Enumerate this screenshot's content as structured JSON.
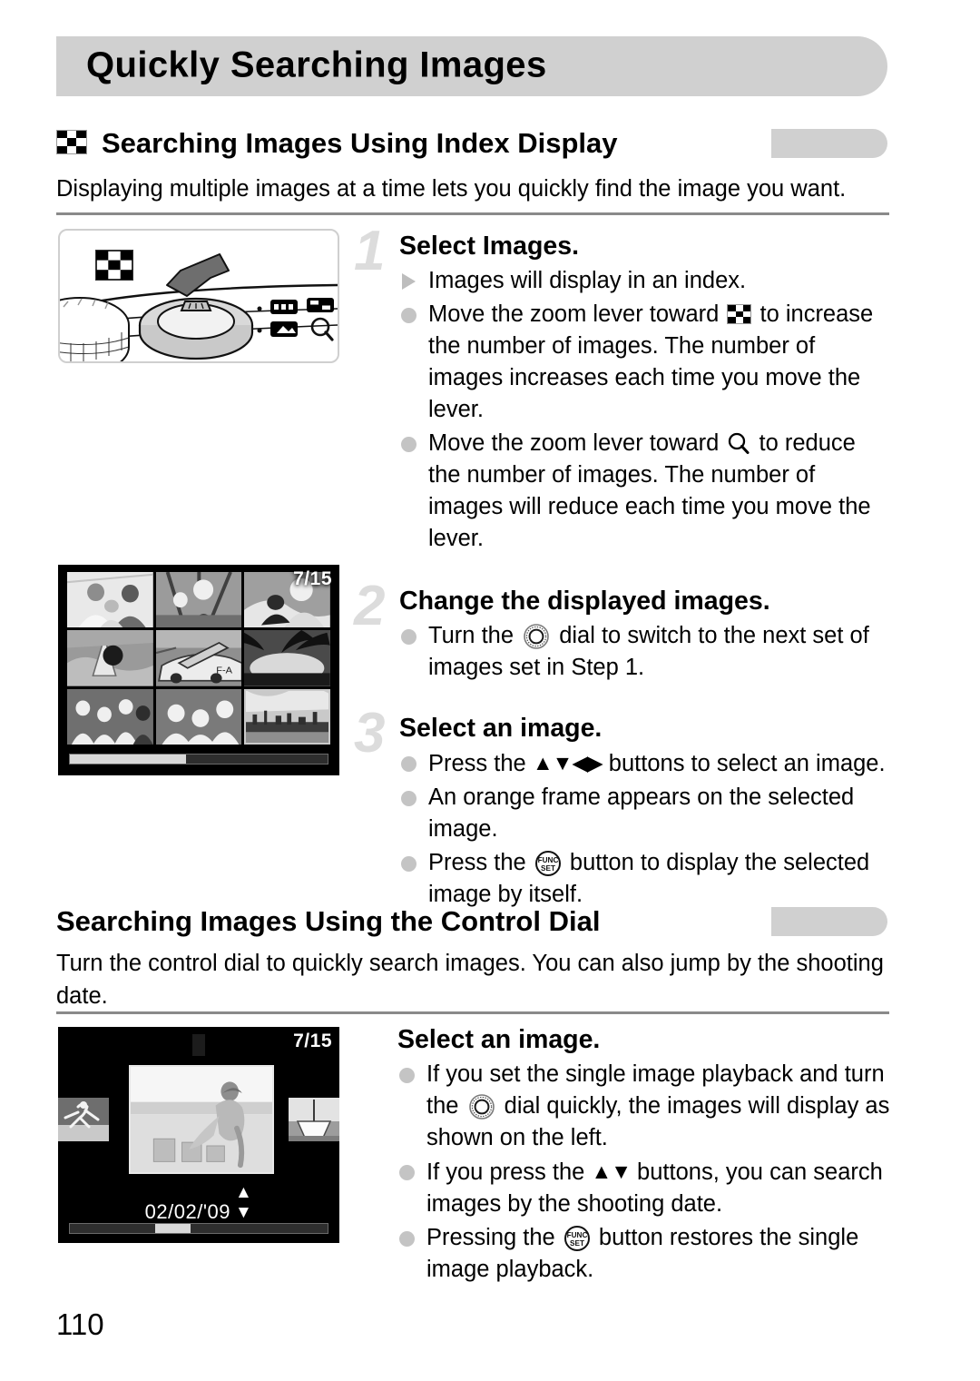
{
  "page": {
    "number": "110",
    "chapter_title": "Quickly Searching Images"
  },
  "sections": [
    {
      "id": "index-display",
      "heading": "Searching Images Using Index Display",
      "heading_icon": "checkerboard-index-icon",
      "intro": "Displaying multiple images at a time lets you quickly find the image you want.",
      "steps": [
        {
          "number": "1",
          "title": "Select Images.",
          "bullets": [
            {
              "marker": "triangle",
              "parts": [
                {
                  "t": "text",
                  "v": "Images will display in an index."
                }
              ]
            },
            {
              "marker": "dot",
              "parts": [
                {
                  "t": "text",
                  "v": "Move the zoom lever toward "
                },
                {
                  "t": "icon",
                  "v": "checkerboard-index-icon"
                },
                {
                  "t": "text",
                  "v": " to increase the number of images. The number of images increases each time you move the lever."
                }
              ]
            },
            {
              "marker": "dot",
              "parts": [
                {
                  "t": "text",
                  "v": "Move the zoom lever toward "
                },
                {
                  "t": "icon",
                  "v": "magnifier-icon"
                },
                {
                  "t": "text",
                  "v": " to reduce the number of images. The number of images will reduce each time you move the lever."
                }
              ]
            }
          ]
        },
        {
          "number": "2",
          "title": "Change the displayed images.",
          "bullets": [
            {
              "marker": "dot",
              "parts": [
                {
                  "t": "text",
                  "v": "Turn the "
                },
                {
                  "t": "icon",
                  "v": "control-dial-icon"
                },
                {
                  "t": "text",
                  "v": " dial to switch to the next set of images set in Step 1."
                }
              ]
            }
          ]
        },
        {
          "number": "3",
          "title": "Select an image.",
          "bullets": [
            {
              "marker": "dot",
              "parts": [
                {
                  "t": "text",
                  "v": "Press the "
                },
                {
                  "t": "icon",
                  "v": "updown-leftright-arrows-icon"
                },
                {
                  "t": "text",
                  "v": " buttons to select an image."
                }
              ]
            },
            {
              "marker": "dot",
              "parts": [
                {
                  "t": "text",
                  "v": "An orange frame appears on the selected image."
                }
              ]
            },
            {
              "marker": "dot",
              "parts": [
                {
                  "t": "text",
                  "v": "Press the "
                },
                {
                  "t": "icon",
                  "v": "func-set-button-icon"
                },
                {
                  "t": "text",
                  "v": " button to display the selected image by itself."
                }
              ]
            }
          ]
        }
      ]
    },
    {
      "id": "control-dial",
      "heading": "Searching Images Using the Control Dial",
      "heading_icon": null,
      "intro": "Turn the control dial to quickly search images. You can also jump by the shooting date.",
      "steps": [
        {
          "number": "",
          "title": "Select an image.",
          "bullets": [
            {
              "marker": "dot",
              "parts": [
                {
                  "t": "text",
                  "v": "If you set the single image playback and turn the "
                },
                {
                  "t": "icon",
                  "v": "control-dial-icon"
                },
                {
                  "t": "text",
                  "v": " dial quickly, the images will display as shown on the left."
                }
              ]
            },
            {
              "marker": "dot",
              "parts": [
                {
                  "t": "text",
                  "v": "If you press the "
                },
                {
                  "t": "icon",
                  "v": "updown-arrows-icon"
                },
                {
                  "t": "text",
                  "v": " buttons, you can search images by the shooting date."
                }
              ]
            },
            {
              "marker": "dot",
              "parts": [
                {
                  "t": "text",
                  "v": "Pressing the "
                },
                {
                  "t": "icon",
                  "v": "func-set-button-icon"
                },
                {
                  "t": "text",
                  "v": " button restores the single image playback."
                }
              ]
            }
          ]
        }
      ]
    }
  ],
  "figures": {
    "zoom_lever": {
      "name": "camera-zoom-lever-illustration",
      "icon_label": "checkerboard-index-icon",
      "arrow": "thick-arrow-icon"
    },
    "index_display": {
      "name": "index-display-screen",
      "counter": "7/15",
      "columns": 3,
      "rows": 3,
      "selected_index": 8,
      "scroll_thumb_percent": 45,
      "thumbnails": [
        "family-portrait",
        "children-playground",
        "couple-dog",
        "monument-tower",
        "airplane-F-A",
        "palm-tree-sunset",
        "group-of-girls",
        "four-girls-smiling",
        "city-skyline"
      ]
    },
    "control_dial_display": {
      "name": "control-dial-jump-screen",
      "counter": "7/15",
      "date": "02/02/'09",
      "date_arrows": "updown-arrows-icon",
      "scroll_thumb_percent": 33,
      "center_thumbnail": "girl-sandcastle-beach",
      "left_thumbnail": "person-jumping",
      "right_thumbnail": "boat-bow"
    }
  },
  "colors": {
    "banner_gray": "#d0d0d0",
    "rule_gray": "#8a8a8a",
    "bullet_gray": "#c4c4c4",
    "step_number_gray": "#dcdcdc"
  }
}
